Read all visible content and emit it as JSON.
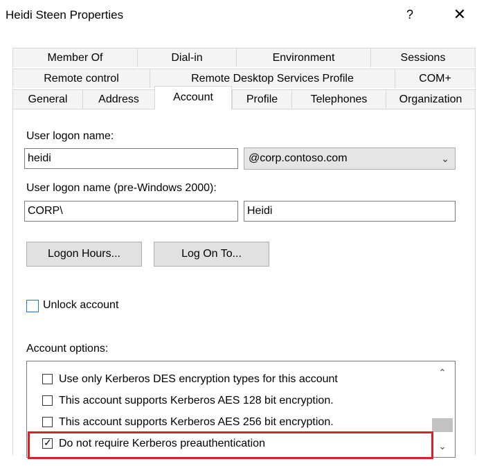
{
  "window": {
    "title": "Heidi Steen Properties",
    "help_label": "?",
    "close_label": "✕"
  },
  "tabs": {
    "row1": [
      "Member Of",
      "Dial-in",
      "Environment",
      "Sessions"
    ],
    "row2": [
      "Remote control",
      "Remote Desktop Services Profile",
      "COM+"
    ],
    "row3": [
      "General",
      "Address",
      "Account",
      "Profile",
      "Telephones",
      "Organization"
    ],
    "active": "Account"
  },
  "account": {
    "logon_name_label": "User logon name:",
    "logon_name_value": "heidi",
    "domain_value": "@corp.contoso.com",
    "pre2000_label": "User logon name (pre-Windows 2000):",
    "pre2000_domain": "CORP\\",
    "pre2000_user": "Heidi",
    "logon_hours_button": "Logon Hours...",
    "log_on_to_button": "Log On To...",
    "unlock_label": "Unlock account",
    "unlock_checked": false,
    "options_label": "Account options:",
    "options": [
      {
        "label": "Use only Kerberos DES encryption types for this account",
        "checked": false
      },
      {
        "label": "This account supports Kerberos AES 128 bit encryption.",
        "checked": false
      },
      {
        "label": "This account supports Kerberos AES 256 bit encryption.",
        "checked": false
      },
      {
        "label": "Do not require Kerberos preauthentication",
        "checked": true
      }
    ]
  },
  "colors": {
    "highlight": "#d6202a",
    "checkbox_accent": "#1979ca"
  }
}
